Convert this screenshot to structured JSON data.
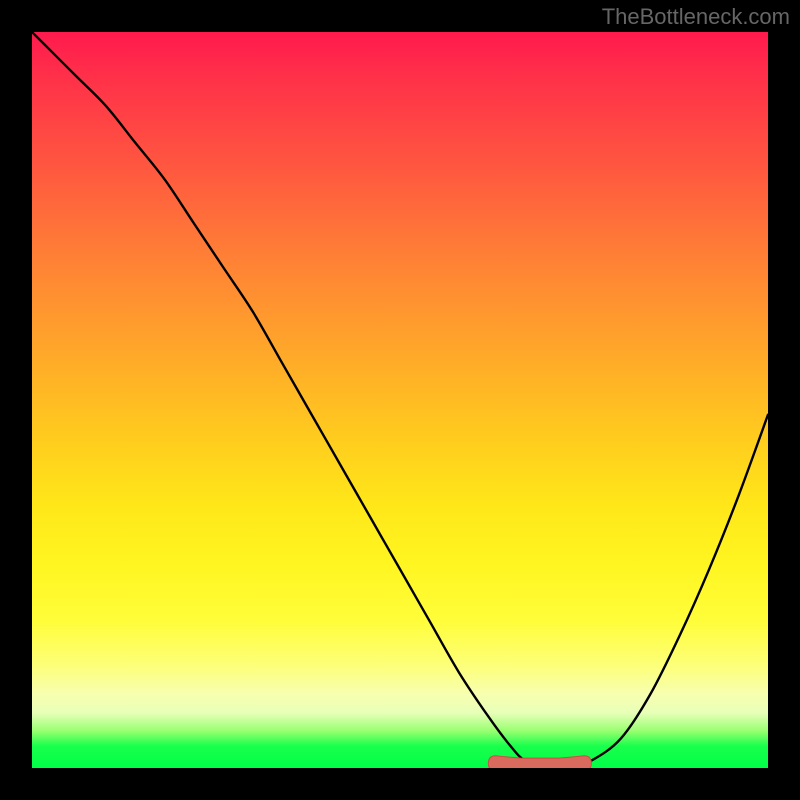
{
  "attribution": "TheBottleneck.com",
  "colors": {
    "page_bg": "#000000",
    "curve": "#000000",
    "marker_fill": "#d86a5e",
    "marker_stroke": "#c94f45",
    "gradient_top": "#ff1a4d",
    "gradient_bottom": "#00ff47"
  },
  "chart_data": {
    "type": "line",
    "title": "",
    "xlabel": "",
    "ylabel": "",
    "xlim": [
      0,
      100
    ],
    "ylim": [
      0,
      100
    ],
    "grid": false,
    "legend": false,
    "series": [
      {
        "name": "bottleneck-curve",
        "x": [
          0,
          3,
          6,
          10,
          14,
          18,
          22,
          26,
          30,
          34,
          38,
          42,
          46,
          50,
          54,
          58,
          62,
          65,
          67,
          70,
          73,
          76,
          80,
          84,
          88,
          92,
          96,
          100
        ],
        "values": [
          100,
          97,
          94,
          90,
          85,
          80,
          74,
          68,
          62,
          55,
          48,
          41,
          34,
          27,
          20,
          13,
          7,
          3,
          1,
          0,
          0,
          1,
          4,
          10,
          18,
          27,
          37,
          48
        ]
      }
    ],
    "marker": {
      "name": "optimal-range",
      "x_start": 62,
      "x_end": 76,
      "y": 0.6
    },
    "notes": "Tick labels and axis text are not shown in the source image; values are estimated from pixel positions."
  }
}
